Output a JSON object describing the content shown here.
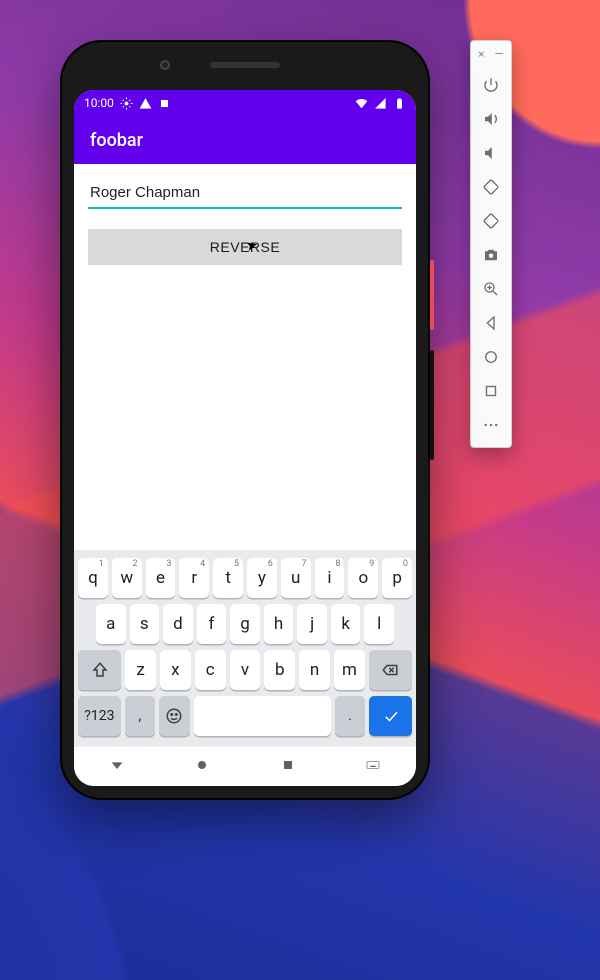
{
  "status_bar": {
    "time": "10:00"
  },
  "app_bar": {
    "title": "foobar"
  },
  "form": {
    "name_value": "Roger Chapman",
    "reverse_label": "REVERSE"
  },
  "keyboard": {
    "row1": [
      {
        "main": "q",
        "sup": "1"
      },
      {
        "main": "w",
        "sup": "2"
      },
      {
        "main": "e",
        "sup": "3"
      },
      {
        "main": "r",
        "sup": "4"
      },
      {
        "main": "t",
        "sup": "5"
      },
      {
        "main": "y",
        "sup": "6"
      },
      {
        "main": "u",
        "sup": "7"
      },
      {
        "main": "i",
        "sup": "8"
      },
      {
        "main": "o",
        "sup": "9"
      },
      {
        "main": "p",
        "sup": "0"
      }
    ],
    "row2": [
      "a",
      "s",
      "d",
      "f",
      "g",
      "h",
      "j",
      "k",
      "l"
    ],
    "row3": [
      "z",
      "x",
      "c",
      "v",
      "b",
      "n",
      "m"
    ],
    "symbols_label": "?123",
    "comma": ",",
    "period": "."
  },
  "emulator_panel": {
    "close": "×",
    "minimize": "—"
  }
}
